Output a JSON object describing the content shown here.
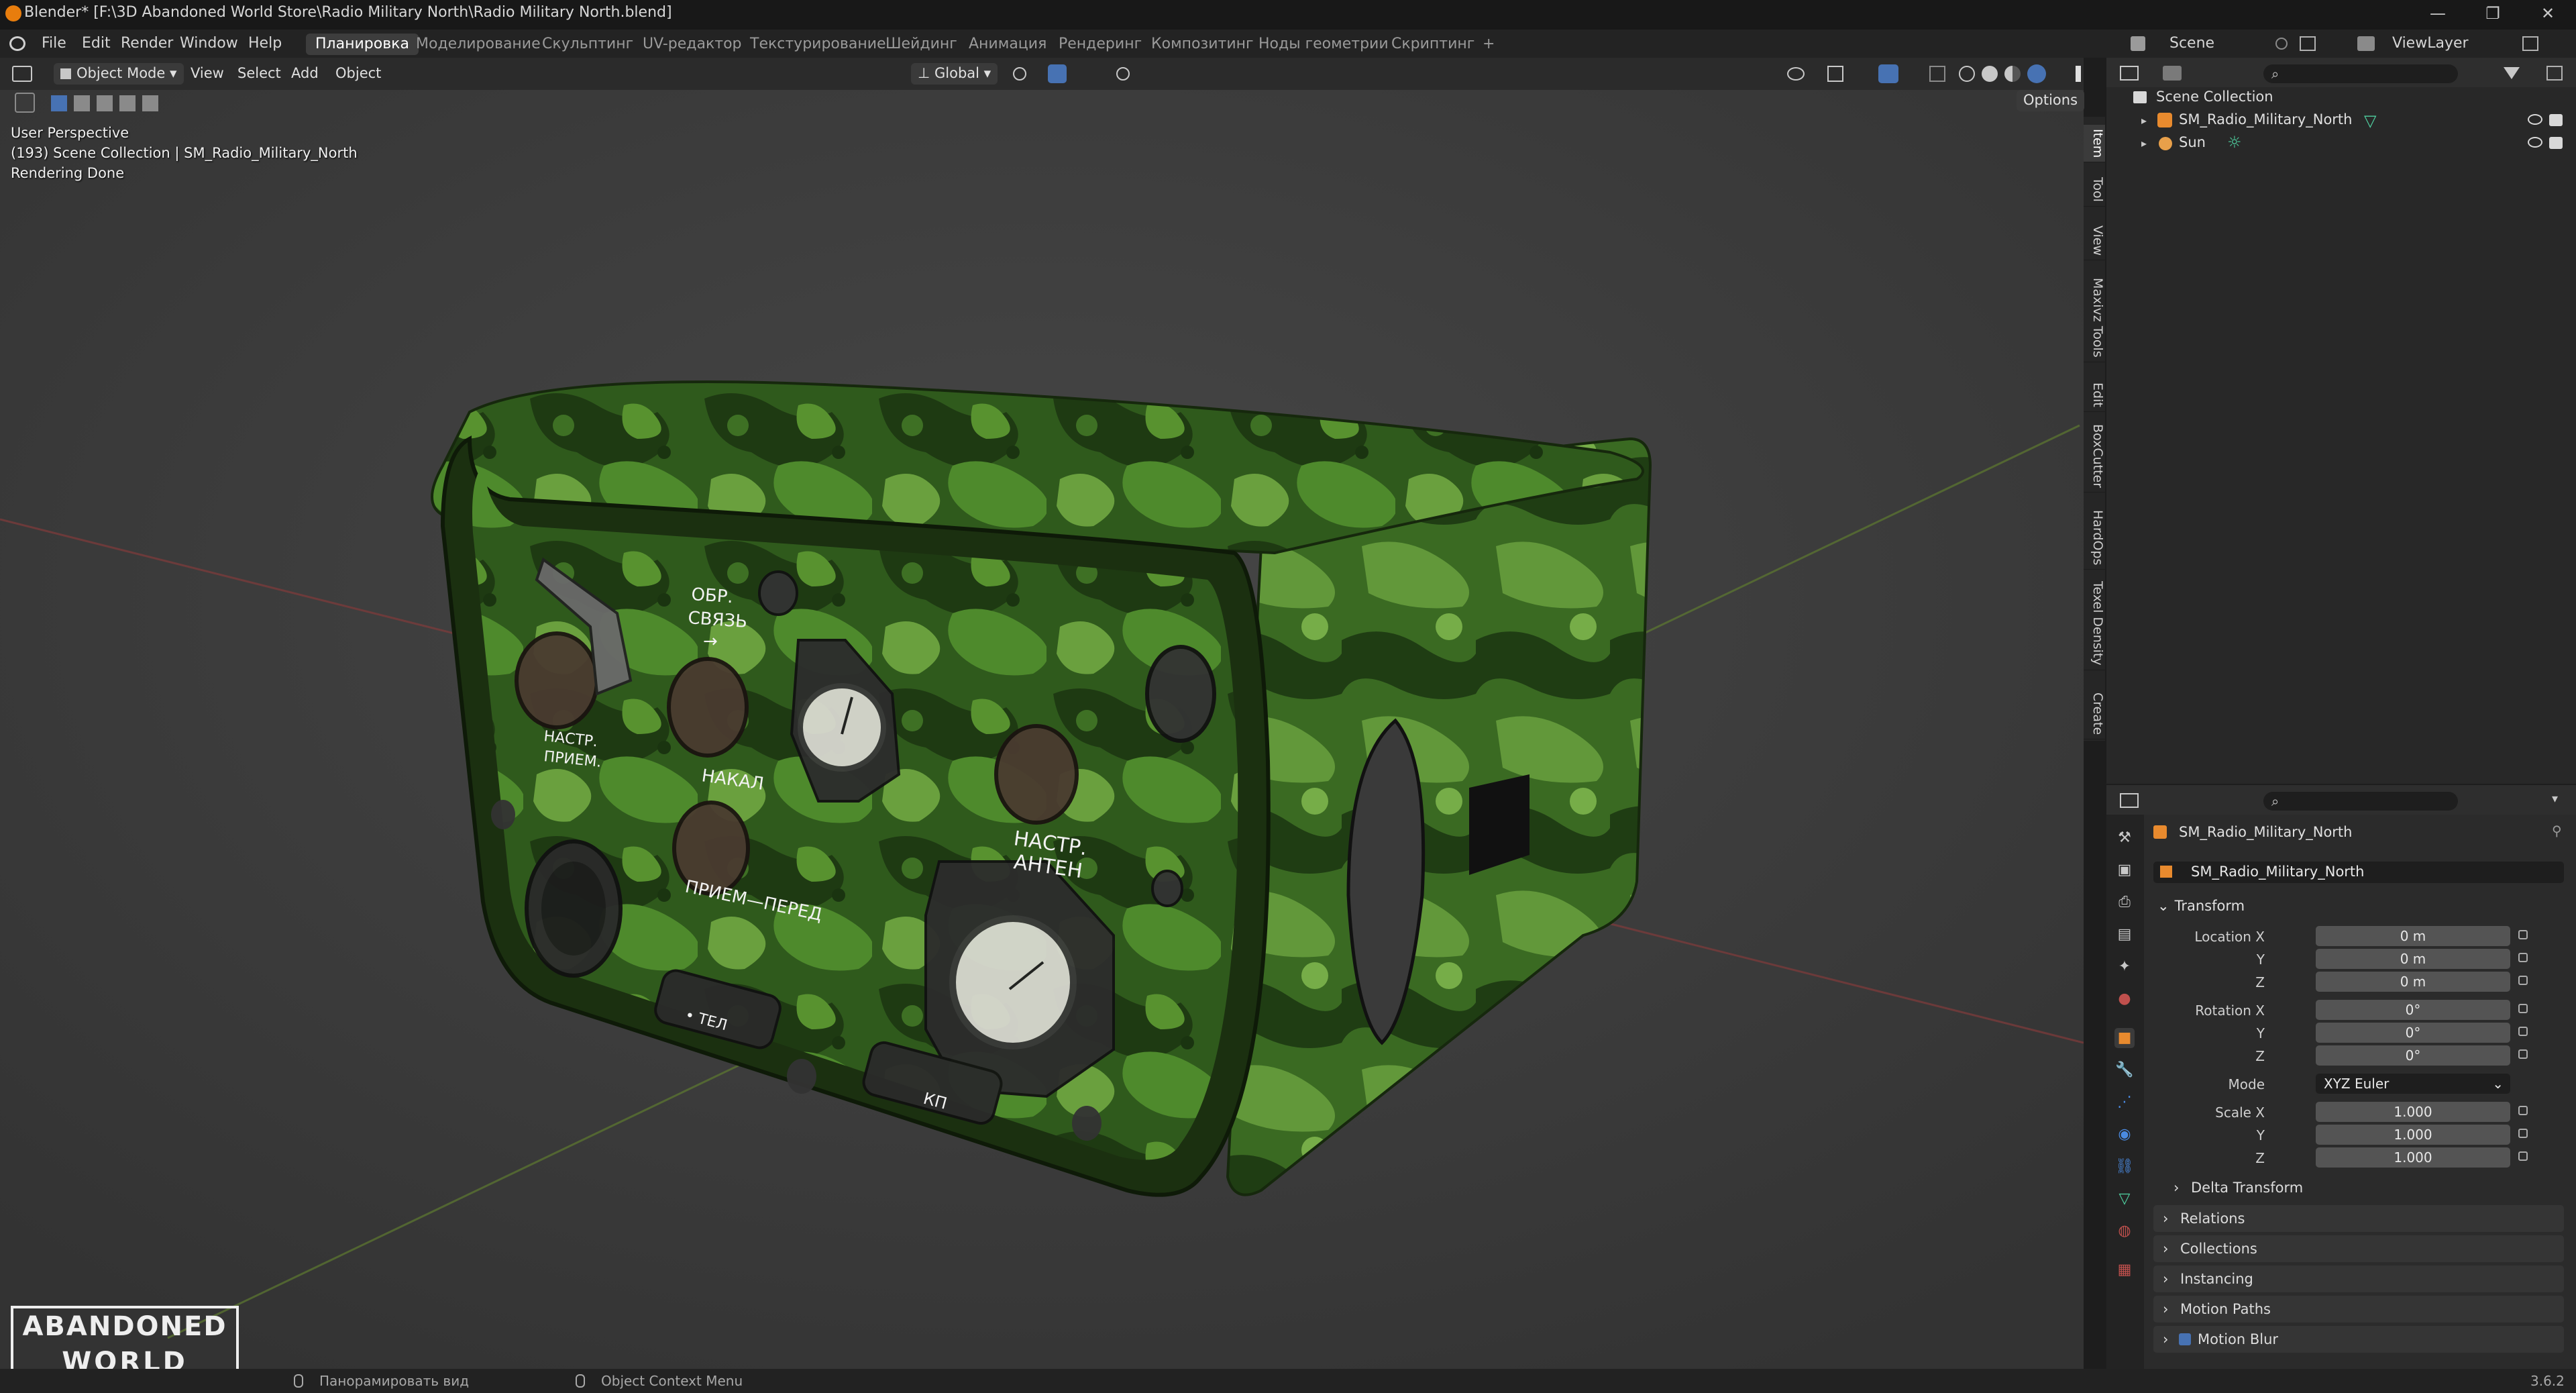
{
  "window": {
    "title": "Blender* [F:\\3D Abandoned World Store\\Radio Military North\\Radio Military North.blend]",
    "controls": [
      "—",
      "❐",
      "✕"
    ]
  },
  "menu": {
    "items": [
      "File",
      "Edit",
      "Render",
      "Window",
      "Help"
    ],
    "workspaces": [
      "Планировка",
      "Моделирование",
      "Скульптинг",
      "UV-редактор",
      "Текстурирование",
      "Шейдинг",
      "Анимация",
      "Рендеринг",
      "Композитинг",
      "Ноды геометрии",
      "Скриптинг"
    ],
    "active_workspace": "Планировка",
    "add_workspace": "+",
    "scene_label": "Scene",
    "viewlayer_label": "ViewLayer"
  },
  "viewport_header": {
    "mode": "Object Mode",
    "menus": [
      "View",
      "Select",
      "Add",
      "Object"
    ],
    "orientation": "Global",
    "options": "Options"
  },
  "viewport": {
    "overlay_lines": [
      "User Perspective",
      "(193) Scene Collection | SM_Radio_Military_North",
      "Rendering Done"
    ],
    "watermark_line1": "ABANDONED",
    "watermark_line2": "WORLD",
    "model_labels": {
      "obr": "ОБР.",
      "svyaz": "СВЯЗЬ",
      "arrow": "→",
      "nastr_priem_1": "НАСТР.",
      "nastr_priem_2": "ПРИЕМ.",
      "nakal": "НАКАЛ",
      "nastr_anten_1": "НАСТР.",
      "nastr_anten_2": "АНТЕН",
      "priem_pered": "ПРИЕМ—ПЕРЕД",
      "tel": "• ТЕЛ",
      "kp": "КП"
    }
  },
  "npanel_tabs": [
    "Item",
    "Tool",
    "View",
    "Maxivz Tools",
    "Edit",
    "BoxCutter",
    "HardOps",
    "Texel Density",
    "Create"
  ],
  "outliner": {
    "root": "Scene Collection",
    "items": [
      {
        "name": "SM_Radio_Military_North",
        "icon": "mesh-object-icon"
      },
      {
        "name": "Sun",
        "icon": "light-icon"
      }
    ]
  },
  "properties": {
    "object_name": "SM_Radio_Military_North",
    "data_name": "SM_Radio_Military_North",
    "transform_title": "Transform",
    "location": {
      "label": "Location X",
      "x": "0 m",
      "y": "0 m",
      "z": "0 m"
    },
    "rotation": {
      "label": "Rotation X",
      "x": "0°",
      "y": "0°",
      "z": "0°"
    },
    "mode_label": "Mode",
    "mode_value": "XYZ Euler",
    "scale": {
      "label": "Scale X",
      "x": "1.000",
      "y": "1.000",
      "z": "1.000"
    },
    "axis_y": "Y",
    "axis_z": "Z",
    "delta": "Delta Transform",
    "sections": [
      "Relations",
      "Collections",
      "Instancing",
      "Motion Paths",
      "Motion Blur"
    ]
  },
  "status": {
    "pan": "Панорамировать вид",
    "context": "Object Context Menu",
    "version": "3.6.2"
  },
  "colors": {
    "accent": "#4772b3",
    "camo_dark": "#1f3a14",
    "camo_mid": "#3c6b25",
    "camo_light": "#6aa03e",
    "grid_red": "#8a3a3a",
    "grid_green": "#5c7a2a"
  }
}
